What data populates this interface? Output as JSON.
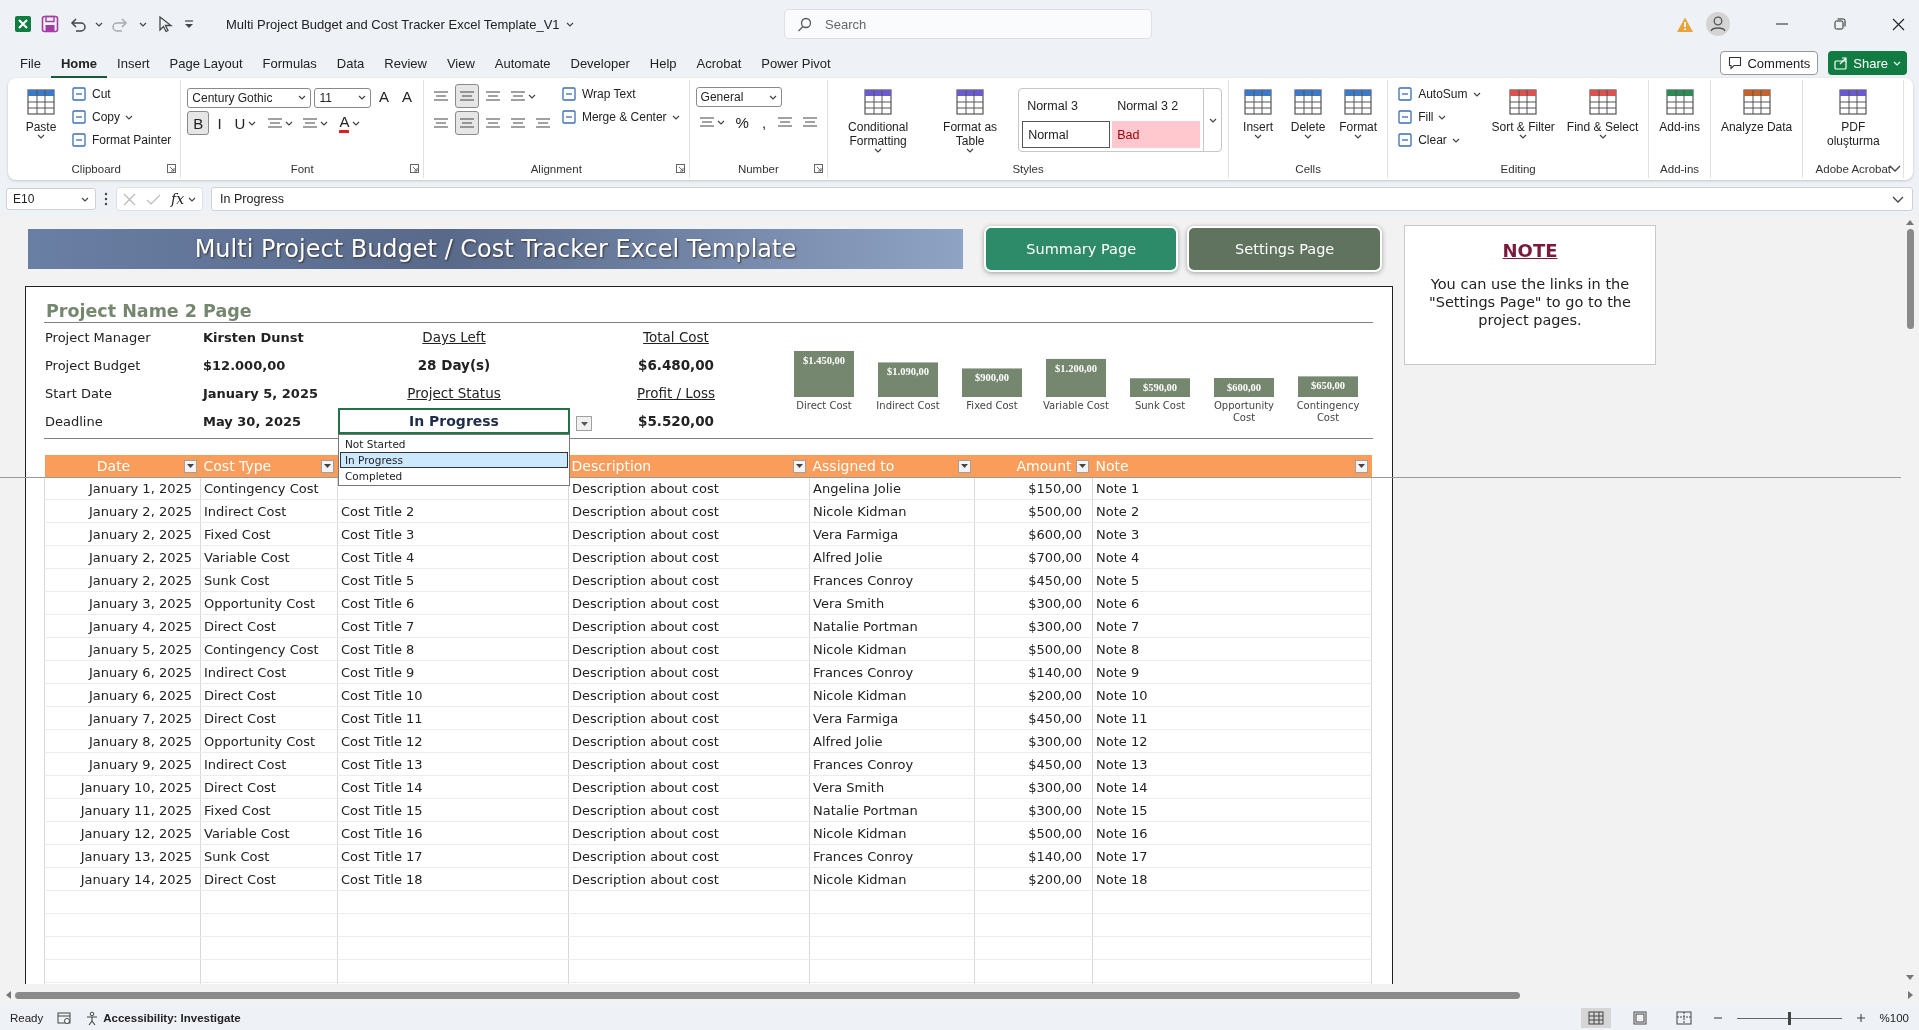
{
  "window": {
    "title": "Multi Project Budget and Cost Tracker Excel Template_V1",
    "search": {
      "placeholder": "Search"
    }
  },
  "menu": {
    "tabs": [
      {
        "label": "File",
        "selected": false
      },
      {
        "label": "Home",
        "selected": true
      },
      {
        "label": "Insert",
        "selected": false
      },
      {
        "label": "Page Layout",
        "selected": false
      },
      {
        "label": "Formulas",
        "selected": false
      },
      {
        "label": "Data",
        "selected": false
      },
      {
        "label": "Review",
        "selected": false
      },
      {
        "label": "View",
        "selected": false
      },
      {
        "label": "Automate",
        "selected": false
      },
      {
        "label": "Developer",
        "selected": false
      },
      {
        "label": "Help",
        "selected": false
      },
      {
        "label": "Acrobat",
        "selected": false
      },
      {
        "label": "Power Pivot",
        "selected": false
      }
    ],
    "comments": "Comments",
    "share": "Share"
  },
  "ribbon": [
    {
      "label": "Clipboard",
      "launcher": true,
      "items": [
        {
          "kind": "large",
          "label": "Paste",
          "dropdown": true
        },
        {
          "kind": "stack",
          "lines": [
            {
              "controls": [
                {
                  "kind": "small",
                  "label": "Cut",
                  "dropdown": false
                }
              ]
            },
            {
              "controls": [
                {
                  "kind": "small",
                  "label": "Copy",
                  "dropdown": true
                }
              ]
            },
            {
              "controls": [
                {
                  "kind": "small",
                  "label": "Format Painter",
                  "dropdown": false
                }
              ]
            }
          ]
        }
      ]
    },
    {
      "label": "Font",
      "launcher": true,
      "items": [
        {
          "kind": "stack",
          "lines": [
            {
              "controls": [
                {
                  "kind": "combo",
                  "value": "Century Gothic"
                },
                {
                  "kind": "combo",
                  "value": "11"
                },
                {
                  "kind": "glyph",
                  "label": "A",
                  "on": false,
                  "dropdown": false
                },
                {
                  "kind": "glyph",
                  "label": "A",
                  "on": false,
                  "dropdown": false
                }
              ]
            },
            {
              "controls": [
                {
                  "kind": "glyph",
                  "label": "B",
                  "on": true,
                  "dropdown": false
                },
                {
                  "kind": "glyph",
                  "label": "I",
                  "on": false,
                  "dropdown": false
                },
                {
                  "kind": "glyph",
                  "label": "U",
                  "on": false,
                  "dropdown": true
                },
                {
                  "kind": "icon",
                  "on": false,
                  "dropdown": true
                },
                {
                  "kind": "icon",
                  "on": false,
                  "dropdown": true
                },
                {
                  "kind": "color-glyph",
                  "label": "A",
                  "on": false,
                  "dropdown": true
                }
              ]
            }
          ]
        }
      ]
    },
    {
      "label": "Alignment",
      "launcher": true,
      "items": [
        {
          "kind": "stack",
          "lines": [
            {
              "controls": [
                {
                  "kind": "icon",
                  "on": false,
                  "dropdown": false
                },
                {
                  "kind": "icon",
                  "on": true,
                  "dropdown": false
                },
                {
                  "kind": "icon",
                  "on": false,
                  "dropdown": false
                },
                {
                  "kind": "icon",
                  "on": false,
                  "dropdown": true
                }
              ]
            },
            {
              "controls": [
                {
                  "kind": "icon",
                  "on": false,
                  "dropdown": false
                },
                {
                  "kind": "icon",
                  "on": true,
                  "dropdown": false
                },
                {
                  "kind": "icon",
                  "on": false,
                  "dropdown": false
                },
                {
                  "kind": "icon",
                  "on": false,
                  "dropdown": false
                },
                {
                  "kind": "icon",
                  "on": false,
                  "dropdown": false
                }
              ]
            }
          ]
        },
        {
          "kind": "stack",
          "lines": [
            {
              "controls": [
                {
                  "kind": "small",
                  "label": "Wrap Text",
                  "dropdown": false
                }
              ]
            },
            {
              "controls": [
                {
                  "kind": "small",
                  "label": "Merge & Center",
                  "dropdown": true
                }
              ]
            }
          ]
        }
      ]
    },
    {
      "label": "Number",
      "launcher": true,
      "items": [
        {
          "kind": "stack",
          "lines": [
            {
              "controls": [
                {
                  "kind": "combo",
                  "value": "General"
                }
              ]
            },
            {
              "controls": [
                {
                  "kind": "icon",
                  "on": false,
                  "dropdown": true
                },
                {
                  "kind": "glyph",
                  "label": "%",
                  "on": false,
                  "dropdown": false
                },
                {
                  "kind": "glyph",
                  "label": ",",
                  "on": false,
                  "dropdown": false
                },
                {
                  "kind": "icon",
                  "on": false,
                  "dropdown": false
                },
                {
                  "kind": "icon",
                  "on": false,
                  "dropdown": false
                }
              ]
            }
          ]
        }
      ]
    },
    {
      "label": "Styles",
      "launcher": false,
      "items": [
        {
          "kind": "large",
          "label": "Conditional Formatting",
          "dropdown": true
        },
        {
          "kind": "large",
          "label": "Format as Table",
          "dropdown": true
        },
        {
          "kind": "gallery",
          "cells": [
            {
              "kind": "plain",
              "label": "Normal 3"
            },
            {
              "kind": "plain",
              "label": "Normal 3 2"
            },
            {
              "kind": "framed",
              "label": "Normal"
            },
            {
              "kind": "bad",
              "label": "Bad"
            }
          ]
        }
      ]
    },
    {
      "label": "Cells",
      "launcher": false,
      "items": [
        {
          "kind": "large",
          "label": "Insert",
          "dropdown": true
        },
        {
          "kind": "large",
          "label": "Delete",
          "dropdown": true
        },
        {
          "kind": "large",
          "label": "Format",
          "dropdown": true
        }
      ]
    },
    {
      "label": "Editing",
      "launcher": false,
      "items": [
        {
          "kind": "stack",
          "lines": [
            {
              "controls": [
                {
                  "kind": "small",
                  "label": "AutoSum",
                  "dropdown": true
                }
              ]
            },
            {
              "controls": [
                {
                  "kind": "small",
                  "label": "Fill",
                  "dropdown": true
                }
              ]
            },
            {
              "controls": [
                {
                  "kind": "small",
                  "label": "Clear",
                  "dropdown": true
                }
              ]
            }
          ]
        },
        {
          "kind": "large",
          "label": "Sort & Filter",
          "dropdown": true
        },
        {
          "kind": "large",
          "label": "Find & Select",
          "dropdown": true
        }
      ]
    },
    {
      "label": "Add-ins",
      "launcher": false,
      "items": [
        {
          "kind": "large",
          "label": "Add-ins",
          "dropdown": false
        }
      ]
    },
    {
      "launcher": false,
      "items": [
        {
          "kind": "large",
          "label": "Analyze Data",
          "dropdown": false
        }
      ]
    },
    {
      "label": "Adobe Acrobat",
      "launcher": false,
      "items": [
        {
          "kind": "large",
          "label": "PDF oluşturma",
          "dropdown": false
        }
      ]
    }
  ],
  "formula_bar": {
    "cell": "E10",
    "function_label": "fx",
    "value": "In Progress"
  },
  "sheet": {
    "banner": "Multi Project Budget / Cost Tracker Excel Template",
    "buttons": [
      {
        "kind": "summary",
        "label": "Summary Page"
      },
      {
        "kind": "settings",
        "label": "Settings Page"
      }
    ],
    "note": {
      "title": "NOTE",
      "text": "You can use the links in the \"Settings Page\" to go to the project pages."
    },
    "project": {
      "title": "Project Name 2 Page",
      "fields": [
        {
          "label": "Project Manager",
          "value": "Kirsten Dunst"
        },
        {
          "label": "Project Budget",
          "value": "$12.000,00"
        },
        {
          "label": "Start Date",
          "value": "January 5, 2025"
        },
        {
          "label": "Deadline",
          "value": "May 30, 2025"
        }
      ],
      "days_left": {
        "label": "Days Left",
        "value": "28 Day(s)"
      },
      "status": {
        "label": "Project Status",
        "value": "In Progress",
        "options": [
          {
            "label": "Not Started",
            "selected": false
          },
          {
            "label": "In Progress",
            "selected": true
          },
          {
            "label": "Completed",
            "selected": false
          }
        ]
      },
      "total_cost": {
        "label": "Total Cost",
        "value": "$6.480,00"
      },
      "profit_loss": {
        "label": "Profit / Loss",
        "value": "$5.520,00"
      },
      "chart_data": {
        "type": "bar",
        "categories": [
          "Direct Cost",
          "Indirect Cost",
          "Fixed Cost",
          "Variable Cost",
          "Sunk Cost",
          "Opportunity Cost",
          "Contingency Cost"
        ],
        "values": [
          1450,
          1090,
          900,
          1200,
          590,
          600,
          650
        ],
        "value_labels": [
          "$1.450,00",
          "$1.090,00",
          "$900,00",
          "$1.200,00",
          "$590,00",
          "$600,00",
          "$650,00"
        ]
      }
    },
    "table": {
      "columns": [
        {
          "label": "Date"
        },
        {
          "label": "Cost Type"
        },
        null,
        {
          "label": "Description"
        },
        {
          "label": "Assigned to"
        },
        {
          "label": "Amount"
        },
        {
          "label": "Note"
        }
      ],
      "rows": [
        [
          "January 1, 2025",
          "Contingency Cost",
          null,
          "Description about cost",
          "Angelina Jolie",
          "$150,00",
          "Note 1"
        ],
        [
          "January 2, 2025",
          "Indirect Cost",
          "Cost Title 2",
          "Description about cost",
          "Nicole Kidman",
          "$500,00",
          "Note 2"
        ],
        [
          "January 2, 2025",
          "Fixed Cost",
          "Cost Title 3",
          "Description about cost",
          "Vera Farmiga",
          "$600,00",
          "Note 3"
        ],
        [
          "January 2, 2025",
          "Variable Cost",
          "Cost Title 4",
          "Description about cost",
          "Alfred Jolie",
          "$700,00",
          "Note 4"
        ],
        [
          "January 2, 2025",
          "Sunk Cost",
          "Cost Title 5",
          "Description about cost",
          "Frances Conroy",
          "$450,00",
          "Note 5"
        ],
        [
          "January 3, 2025",
          "Opportunity Cost",
          "Cost Title 6",
          "Description about cost",
          "Vera Smith",
          "$300,00",
          "Note 6"
        ],
        [
          "January 4, 2025",
          "Direct Cost",
          "Cost Title 7",
          "Description about cost",
          "Natalie Portman",
          "$300,00",
          "Note 7"
        ],
        [
          "January 5, 2025",
          "Contingency Cost",
          "Cost Title 8",
          "Description about cost",
          "Nicole Kidman",
          "$500,00",
          "Note 8"
        ],
        [
          "January 6, 2025",
          "Indirect Cost",
          "Cost Title 9",
          "Description about cost",
          "Frances Conroy",
          "$140,00",
          "Note 9"
        ],
        [
          "January 6, 2025",
          "Direct Cost",
          "Cost Title 10",
          "Description about cost",
          "Nicole Kidman",
          "$200,00",
          "Note 10"
        ],
        [
          "January 7, 2025",
          "Direct Cost",
          "Cost Title 11",
          "Description about cost",
          "Vera Farmiga",
          "$450,00",
          "Note 11"
        ],
        [
          "January 8, 2025",
          "Opportunity Cost",
          "Cost Title 12",
          "Description about cost",
          "Alfred Jolie",
          "$300,00",
          "Note 12"
        ],
        [
          "January 9, 2025",
          "Indirect Cost",
          "Cost Title 13",
          "Description about cost",
          "Frances Conroy",
          "$450,00",
          "Note 13"
        ],
        [
          "January 10, 2025",
          "Direct Cost",
          "Cost Title 14",
          "Description about cost",
          "Vera Smith",
          "$300,00",
          "Note 14"
        ],
        [
          "January 11, 2025",
          "Fixed Cost",
          "Cost Title 15",
          "Description about cost",
          "Natalie Portman",
          "$300,00",
          "Note 15"
        ],
        [
          "January 12, 2025",
          "Variable Cost",
          "Cost Title 16",
          "Description about cost",
          "Nicole Kidman",
          "$500,00",
          "Note 16"
        ],
        [
          "January 13, 2025",
          "Sunk Cost",
          "Cost Title 17",
          "Description about cost",
          "Frances Conroy",
          "$140,00",
          "Note 17"
        ],
        [
          "January 14, 2025",
          "Direct Cost",
          "Cost Title 18",
          "Description about cost",
          "Nicole Kidman",
          "$200,00",
          "Note 18"
        ]
      ]
    }
  },
  "status_bar": {
    "ready": "Ready",
    "accessibility": "Accessibility: Investigate",
    "views": [
      {
        "selected": true
      },
      {
        "selected": false
      },
      {
        "selected": false
      }
    ],
    "zoom": {
      "level": 0.5,
      "label": "%100"
    }
  }
}
